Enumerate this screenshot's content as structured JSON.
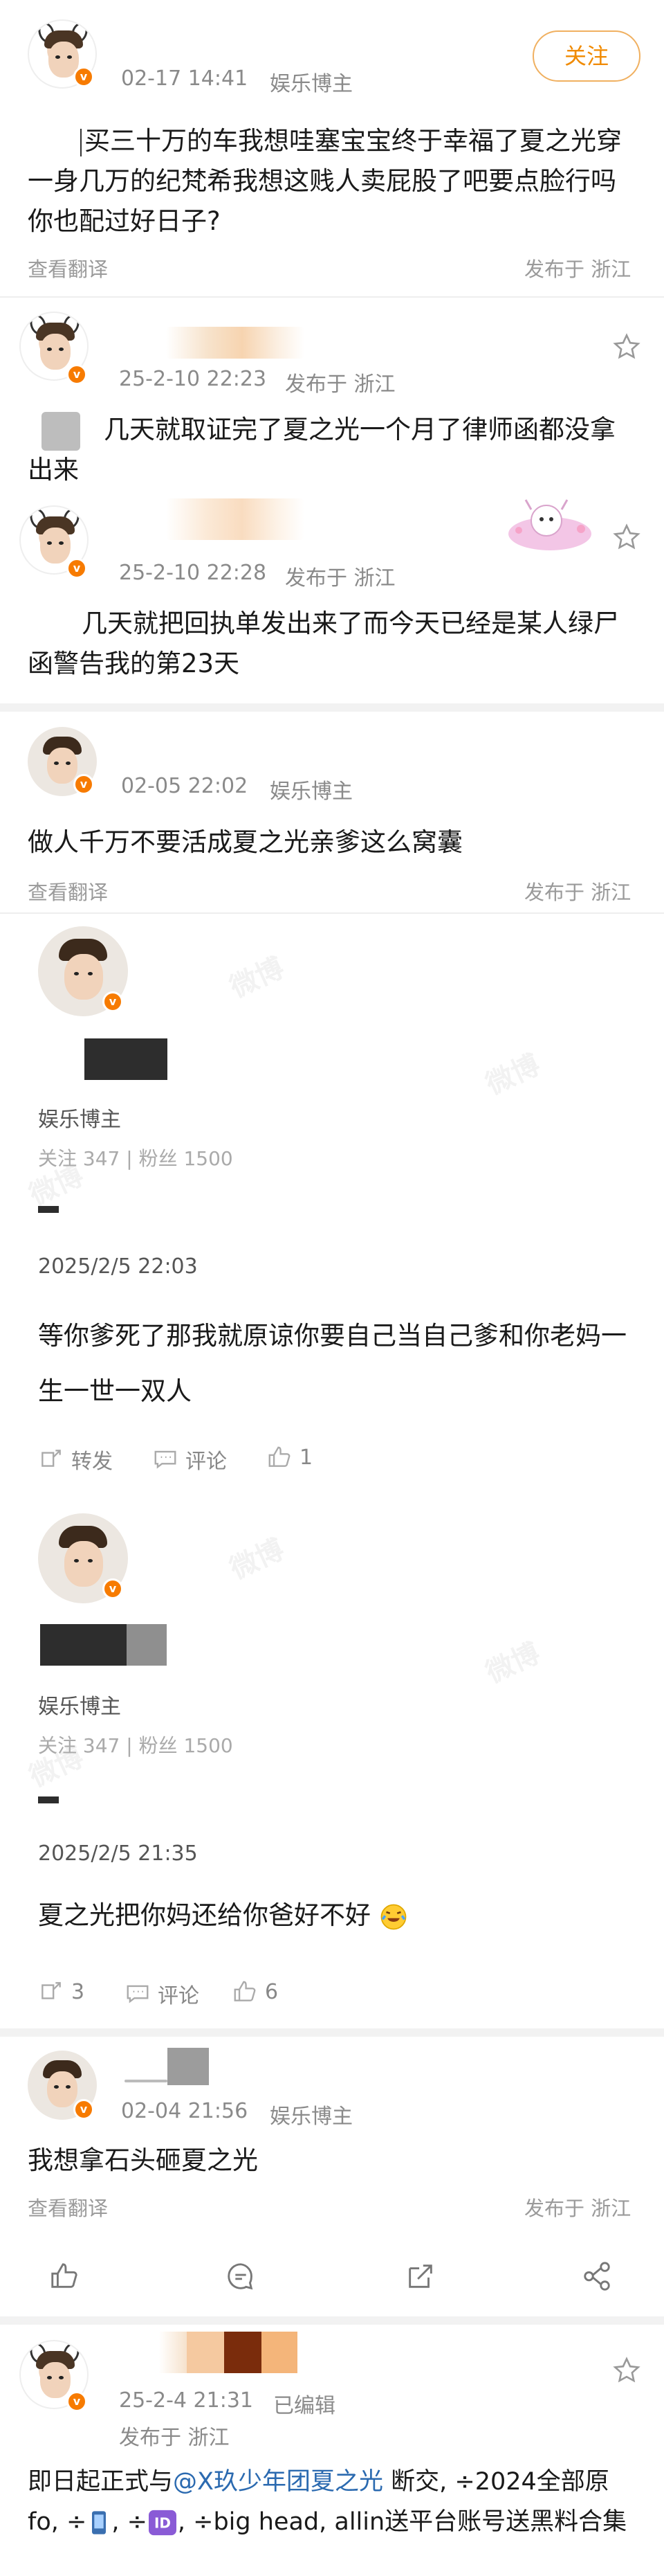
{
  "post1": {
    "time": "02-17 14:41",
    "role": "娱乐博主",
    "follow_label": "关注",
    "content": "买三十万的车我想哇塞宝宝终于幸福了夏之光穿一身几万的纪梵希我想这贱人卖屁股了吧要点脸行吗你也配过好日子?",
    "translate_label": "查看翻译",
    "location_label": "发布于 浙江"
  },
  "reply1": {
    "date": "25-2-10 22:23",
    "location_label": "发布于 浙江",
    "content": "几天就取证完了夏之光一个月了律师函都没拿出来"
  },
  "reply2": {
    "date": "25-2-10 22:28",
    "location_label": "发布于 浙江",
    "content": "几天就把回执单发出来了而今天已经是某人绿尸函警告我的第23天"
  },
  "post2": {
    "time": "02-05 22:02",
    "role": "娱乐博主",
    "content": "做人千万不要活成夏之光亲爹这么窝囊",
    "translate_label": "查看翻译",
    "location_label": "发布于 浙江"
  },
  "profile1": {
    "role": "娱乐博主",
    "stats": "关注 347 | 粉丝 1500",
    "date": "2025/2/5 22:03",
    "content": "等你爹死了那我就原谅你要自己当自己爹和你老妈一生一世一双人",
    "repost_label": "转发",
    "comment_label": "评论",
    "like_count": "1"
  },
  "profile2": {
    "role": "娱乐博主",
    "stats": "关注 347 | 粉丝 1500",
    "date": "2025/2/5 21:35",
    "content": "夏之光把你妈还给你爸好不好",
    "repost_count": "3",
    "comment_label": "评论",
    "like_count": "6"
  },
  "post3": {
    "time": "02-04 21:56",
    "role": "娱乐博主",
    "content": "我想拿石头砸夏之光",
    "translate_label": "查看翻译",
    "location_label": "发布于 浙江"
  },
  "post4": {
    "date": "25-2-4 21:31",
    "edited_label": "已编辑",
    "location_label": "发布于 浙江",
    "content_prefix": "即日起正式与",
    "mention": "@X玖少年团夏之光",
    "content_mid": " 断交, ÷2024全部原fo, ÷",
    "content_mid2": ", ÷",
    "content_mid3": ", ÷big head, allin送平台账号送黑料合集"
  },
  "watermark_text": "微博",
  "colors": {
    "accent": "#f08a00",
    "link": "#2b6ab0",
    "badge": "#f77b00"
  }
}
